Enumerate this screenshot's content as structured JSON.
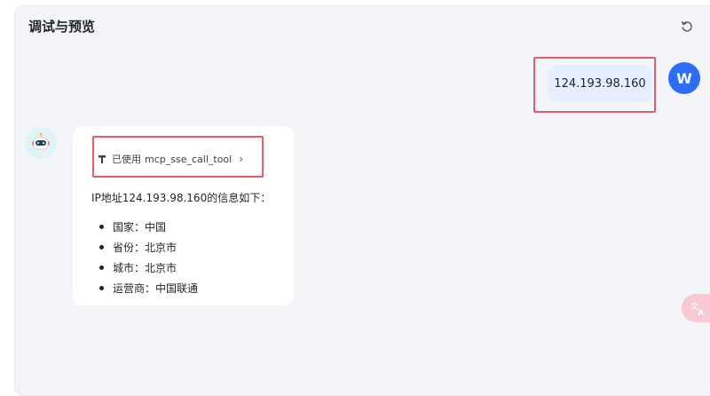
{
  "panel": {
    "title": "调试与预览"
  },
  "icons": {
    "refresh": "refresh-icon",
    "tool": "tool-icon",
    "chevron": "chevron-right-icon",
    "translate": "translate-icon",
    "bot": "robot-icon"
  },
  "user_message": {
    "avatar_letter": "W",
    "text": "124.193.98.160"
  },
  "bot_message": {
    "tool_chip": {
      "prefix": "已使用",
      "tool_name": "mcp_sse_call_tool",
      "chevron": "›"
    },
    "intro": "IP地址124.193.98.160的信息如下：",
    "items": [
      "国家：中国",
      "省份：北京市",
      "城市：北京市",
      "运营商：中国联通"
    ]
  },
  "colors": {
    "accent": "#2d6cf6",
    "user_bubble": "#e6efff",
    "highlight": "#e85b6c",
    "panel_bg": "#f4f5f8"
  }
}
